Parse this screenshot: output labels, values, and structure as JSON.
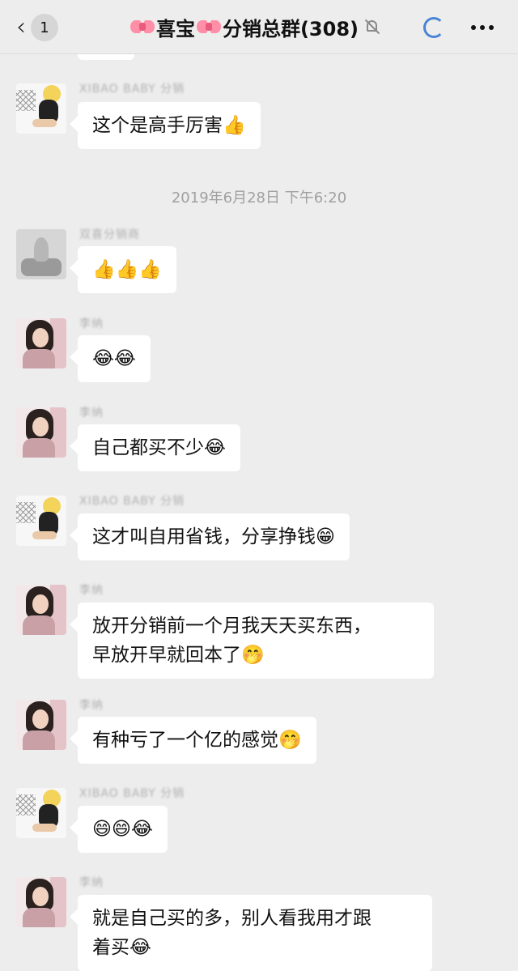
{
  "header": {
    "back_count": "1",
    "title_text": "喜宝",
    "title_suffix": "分销总群(308)"
  },
  "chat": {
    "timestamp": "2019年6月28日 下午6:20",
    "messages": [
      {
        "sender": "XIBAO BABY 分销",
        "text": "这个是高手厉害👍"
      },
      {
        "sender": "双喜分销商",
        "text": "👍👍👍"
      },
      {
        "sender": "李纳",
        "text": "😂😂"
      },
      {
        "sender": "李纳",
        "text": "自己都买不少😂"
      },
      {
        "sender": "XIBAO BABY 分销",
        "text": "这才叫自用省钱，分享挣钱😁"
      },
      {
        "sender": "李纳",
        "text": "放开分销前一个月我天天买东西，\n早放开早就回本了🤭"
      },
      {
        "sender": "李纳",
        "text": "有种亏了一个亿的感觉🤭"
      },
      {
        "sender": "XIBAO BABY 分销",
        "text": "😄😄😂"
      },
      {
        "sender": "李纳",
        "text": "就是自己买的多，别人看我用才跟\n着买😂"
      }
    ]
  }
}
